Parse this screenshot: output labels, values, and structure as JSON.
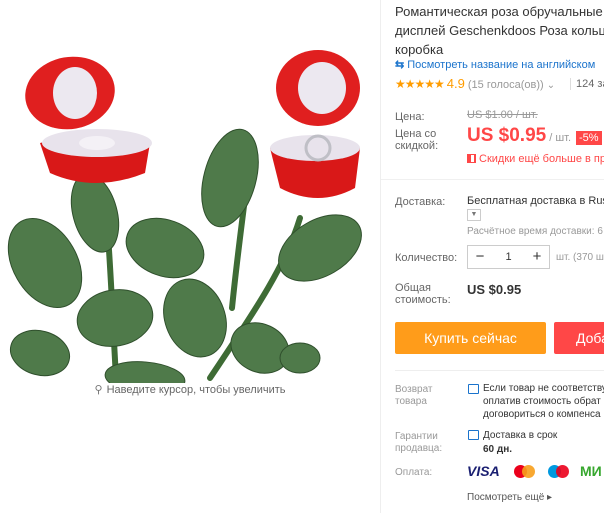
{
  "title": "Романтическая роза обручальные\nдисплей Geschenkdoos Роза кольцо\nкоробка",
  "translate_link": "Посмотреть название на английском",
  "rating": {
    "value": "4.9",
    "count_text": "(15 голоса(ов))",
    "orders": "124 за"
  },
  "zoom_hint": "Наведите курсор, чтобы увеличить",
  "price": {
    "label": "Цена:",
    "old": "US $1.00 / шт.",
    "discount_label": "Цена со\nскидкой:",
    "new": "US $0.95",
    "unit": "/ шт.",
    "discount_badge": "-5%",
    "app_offer": "Скидки ещё больше в при"
  },
  "shipping": {
    "label": "Доставка:",
    "value": "Бесплатная доставка в Rus",
    "time": "Расчётное время доставки: 6"
  },
  "quantity": {
    "label": "Количество:",
    "value": "1",
    "unit": "шт. (370 ш"
  },
  "total": {
    "label": "Общая\nстоимость:",
    "value": "US $0.95"
  },
  "buttons": {
    "buy_now": "Купить сейчас",
    "add_cart": "Доба"
  },
  "returns": {
    "label": "Возврат\nтовара",
    "text": "Если товар не соответству\nоплатив стоимость обрат\nдоговориться о компенса"
  },
  "guarantee": {
    "label": "Гарантии\nпродавца:",
    "text": "Доставка в срок",
    "days": "60 дн."
  },
  "payment": {
    "label": "Оплата:",
    "visa": "VISA",
    "mir": "МИ",
    "more": "Посмотреть ещё ▸"
  },
  "colors": {
    "price_red": "#ff4747",
    "buy_orange": "#ff9c1a",
    "link_blue": "#1a73cc",
    "star": "#ff9c00"
  }
}
